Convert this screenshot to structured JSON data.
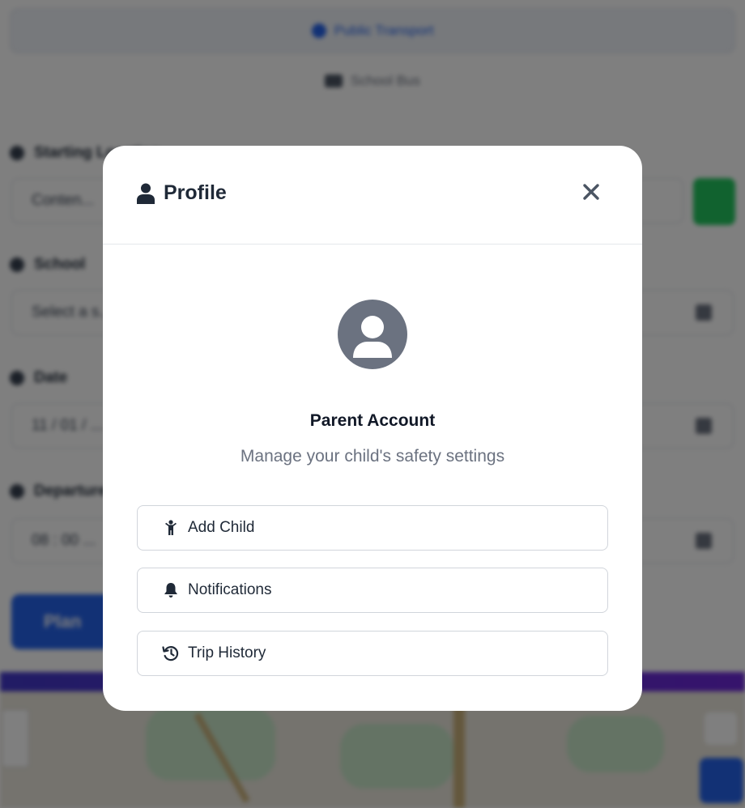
{
  "background": {
    "transport_modes": [
      {
        "label": "Public Transport"
      },
      {
        "label": "School Bus"
      }
    ],
    "fields": [
      {
        "label": "Starting Location",
        "value": "Conten..."
      },
      {
        "label": "School",
        "value": "Select a s..."
      },
      {
        "label": "Date",
        "value": "11 / 01 / ..."
      },
      {
        "label": "Departure",
        "value": "08 : 00 ..."
      }
    ],
    "plan_button_label": "Plan",
    "colors": {
      "accent": "#2563eb",
      "geo_button": "#22c55e",
      "strip": "#4338ca"
    }
  },
  "modal": {
    "title": "Profile",
    "title_icon": "user-icon",
    "close_icon": "close-icon",
    "avatar_icon": "user-circle-icon",
    "account_title": "Parent Account",
    "account_subtitle": "Manage your child's safety settings",
    "actions": [
      {
        "label": "Add Child",
        "icon": "child-icon"
      },
      {
        "label": "Notifications",
        "icon": "bell-icon"
      },
      {
        "label": "Trip History",
        "icon": "history-icon"
      }
    ]
  }
}
